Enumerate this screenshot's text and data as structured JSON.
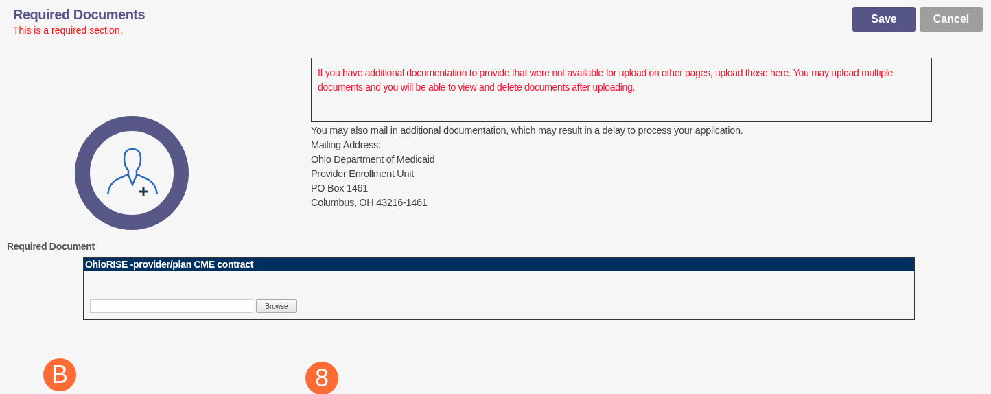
{
  "header": {
    "title": "Required Documents",
    "subtitle": "This is a required section."
  },
  "buttons": [
    {
      "label": "Save",
      "kind": "primary"
    },
    {
      "label": "Cancel",
      "kind": "secondary"
    }
  ],
  "notice": "If you have additional documentation to provide that were not available for upload on other pages, upload those here. You may upload multiple documents and you will be able to view and delete documents after uploading.",
  "mail_info": [
    "You may also mail in additional documentation, which may result in a delay to process your application.",
    "Mailing Address:",
    "Ohio Department of Medicaid",
    "Provider Enrollment Unit",
    "PO Box 1461",
    "Columbus, OH 43216-1461"
  ],
  "required_document": {
    "label": "Required Document",
    "panel_title": "OhioRISE -provider/plan CME contract",
    "browse_label": "Browse"
  },
  "callouts": [
    {
      "label": "B"
    },
    {
      "label": "8"
    }
  ]
}
